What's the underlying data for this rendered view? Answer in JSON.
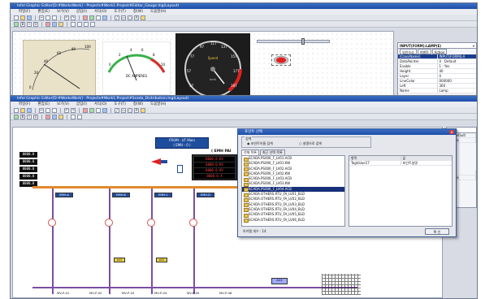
{
  "top_window": {
    "title": "Infol Graphic Editor[D:#WorksWork] - Projects#Work1.Project#Editor_Gauge.Ing(Layout)",
    "menu": [
      "파일(F)",
      "편집(E)",
      "보기(V)",
      "삽입(I)",
      "서식(O)",
      "도구(T)",
      "창(W)",
      "도움말(H)"
    ],
    "gauge1": {
      "scale": [
        "0",
        "20",
        "40",
        "60",
        "80",
        "100"
      ]
    },
    "gauge2": {
      "label": "DC AMPERES",
      "scale": [
        "0",
        "2",
        "4",
        "6",
        "8",
        "10"
      ]
    },
    "gauge3": {
      "label": "Speed",
      "unit": "kmh",
      "scale": [
        "37",
        "57",
        "77",
        "97",
        "117",
        "137",
        "157",
        "177",
        "197"
      ]
    },
    "properties": {
      "header": "INPUT(FORM):LAMP(E)",
      "tabs": [
        "일반속성",
        "이벤트",
        "Action"
      ],
      "rows": [
        [
          "[ClassName]",
          "INPUT(FORM)LA"
        ],
        [
          "DataPointer",
          "0 : Default"
        ],
        [
          "Enable",
          "1 : Yes"
        ],
        [
          "Height",
          "40"
        ],
        [
          "Layer",
          "0"
        ],
        [
          "LineColor",
          "000000"
        ],
        [
          "Left",
          "360"
        ],
        [
          "Name",
          "Lamp"
        ],
        [
          "Top",
          "16"
        ],
        [
          "Visible",
          "1 : Yes"
        ],
        [
          "ToolTipText",
          ""
        ]
      ]
    }
  },
  "bottom_window": {
    "title": "Infol Graphic Editor[D:#WorksWork] - Projects#Work1.Project#Scada_Distribution.Ing(Layout)",
    "menu": [
      "파일(F)",
      "편집(E)",
      "보기(V)",
      "삽입(I)",
      "서식(O)",
      "도구(T)",
      "창(W)",
      "도움말(H)"
    ],
    "side_props": {
      "items": [
        "속성들",
        "0 : Default",
        "1 : Yes",
        "396",
        "1 : Yes"
      ]
    }
  },
  "diagram": {
    "header_title": "FROM : UT Main",
    "header_sub": "( EMH - 0 )",
    "main_panel_title": "( EMH PAI",
    "feeders": [
      "EMH-A",
      "EMH-B",
      "EMH-C",
      "EMH-D",
      "EMH-E"
    ],
    "readings": [
      "0000.0 KV",
      "0000.0 KV",
      "0000.0 KV",
      "0000.0 A"
    ],
    "left_values": [
      "0000.0",
      "0000.0",
      "0000.0",
      "0000.0",
      "0000.0"
    ],
    "mid_label": "LV1",
    "bottom_tags": [
      "MV-P-01",
      "MV-P-02",
      "MV-P-03",
      "MV-P-04",
      "MV-P-05",
      "MV-P-06"
    ],
    "aux_label": "AUX"
  },
  "dialog": {
    "title": "포인트 선택",
    "search_label": "검색",
    "radio1": "포인트이름 검색",
    "radio2": "설명으로 검색",
    "filter_label": "필터",
    "tabs": [
      "전체 목록",
      "최근 선택 목록"
    ],
    "items": [
      "SCADA.PS006_F_LV01.ACB",
      "SCADA.PS006_F_LV01.KW",
      "SCADA.PS006_F_LV02.ACB",
      "SCADA.PS006_F_LV02.KW",
      "SCADA.PS006_F_LV03.ACB",
      "SCADA.PS006_F_LV03.KW",
      "SCADA.PS006_F_LV04.ACB",
      "SCADA.OTHERS.RTU_FA_LV01_BLD",
      "SCADA.OTHERS.RTU_FA_LV02_BLD",
      "SCADA.OTHERS.RTU_FA_LV03_BLD",
      "SCADA.OTHERS.RTU_FA_LV04_BLD",
      "SCADA.OTHERS.RTU_FA_LV05_BLD",
      "SCADA.OTHERS.RTU_FA_LV06_BLD"
    ],
    "selected_index": 6,
    "col_headers": [
      "항목",
      "값"
    ],
    "right_rows": [
      [
        "TagValue17",
        "포인트설명"
      ]
    ],
    "count_label": "아이템 개수 : 14",
    "ok_label": "확 인"
  },
  "colors": {
    "titlebar": "#1d4ea8",
    "bus": "#7b4ea3",
    "panel_blue": "#1f4d9e",
    "alarm_red": "#e02020"
  }
}
